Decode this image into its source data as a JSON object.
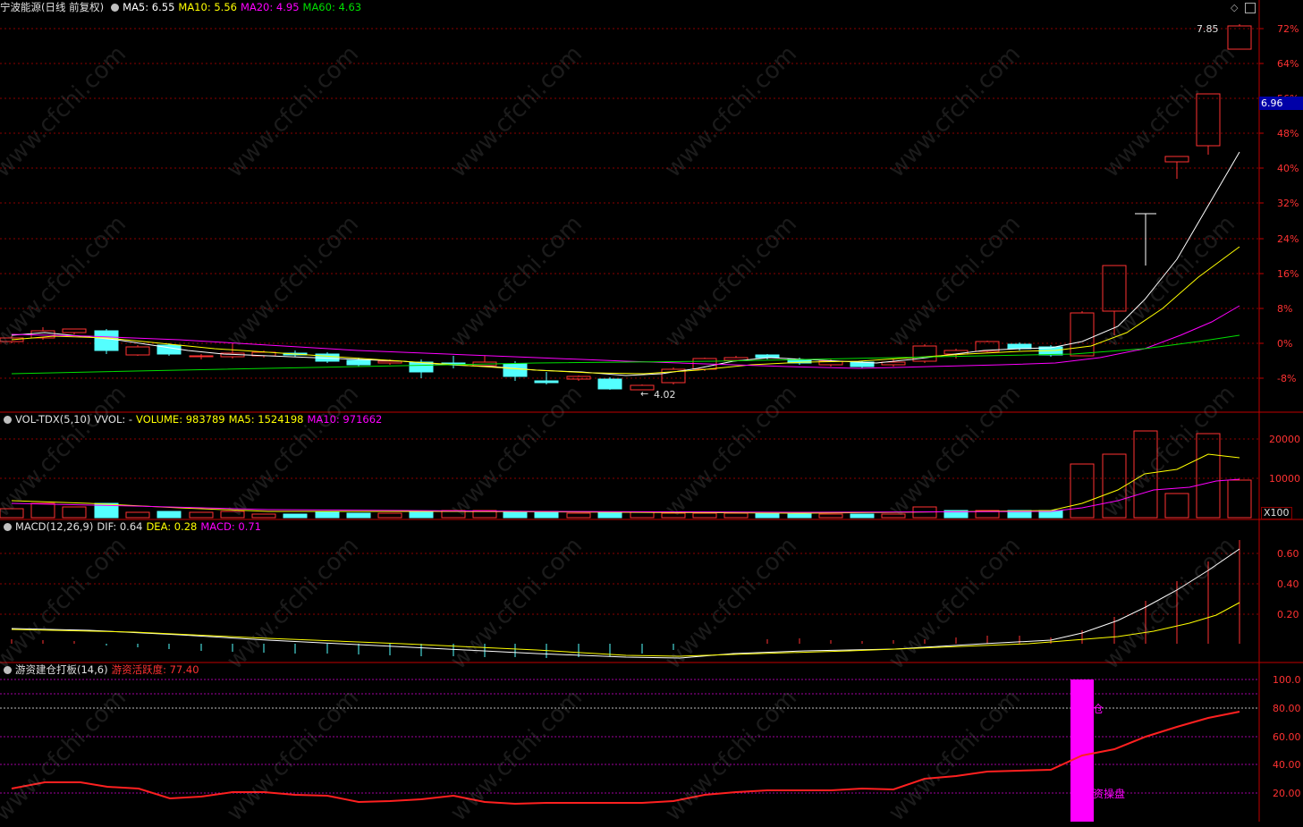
{
  "main": {
    "title": "宁波能源(日线 前复权)",
    "ma5": "MA5: 6.55",
    "ma10": "MA10: 5.56",
    "ma20": "MA20: 4.95",
    "ma60": "MA60: 4.63",
    "pct_ticks": [
      "72%",
      "64%",
      "56%",
      "48%",
      "40%",
      "32%",
      "24%",
      "16%",
      "8%",
      "0%",
      "-8%"
    ],
    "high_label": "7.85",
    "low_label": "4.02",
    "price_tag": "6.96"
  },
  "vol": {
    "name": "VOL-TDX(5,10)",
    "vvol": "VVOL: -",
    "volume": "VOLUME: 983789",
    "ma5": "MA5: 1524198",
    "ma10": "MA10: 971662",
    "ticks": [
      "20000",
      "10000"
    ],
    "unit": "X100"
  },
  "macd": {
    "name": "MACD(12,26,9)",
    "dif": "DIF: 0.64",
    "dea": "DEA: 0.28",
    "macd": "MACD: 0.71",
    "ticks": [
      "0.60",
      "0.40",
      "0.20"
    ]
  },
  "ind": {
    "name": "游资建仓打板(14,6)",
    "value": "游资活跃度: 77.40",
    "ticks": [
      "100.0",
      "80.00",
      "60.00",
      "40.00",
      "20.00"
    ],
    "label1": "仓",
    "label2": "资操盘"
  },
  "watermark": "www.cfchi.com",
  "colors": {
    "up": "#ff3232",
    "down": "#54ffff",
    "ma5": "#ffffff",
    "ma10": "#ffff00",
    "ma20": "#ff00ff",
    "ma60": "#00e000",
    "grid": "#8b0000"
  }
}
